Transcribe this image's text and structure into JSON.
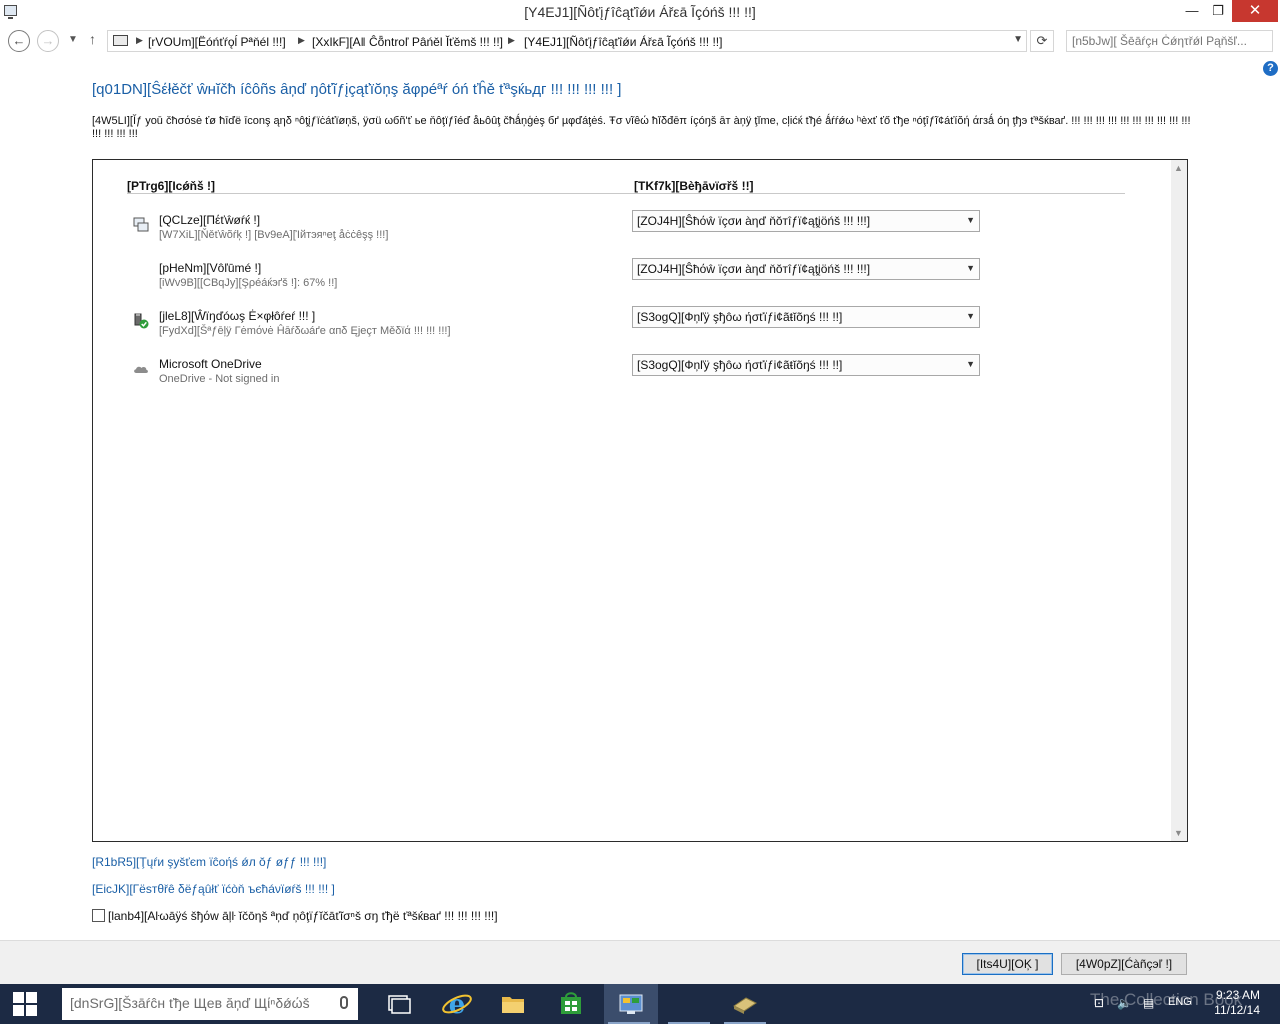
{
  "window": {
    "title": "[Y4EJ1][Ñôťįƒîĉąťîǿи Ářεā Ĩçóńš !!! !!]",
    "minimize": "—",
    "maximize": "❐",
    "close": "✕"
  },
  "address": {
    "crumbs": [
      "[rVOUm][Ёóńťŕǫĺ Pªňél !!!]",
      "[XxIkF][Aǁ Ĉȭntroľ Pâńěl Ĭťěmš !!! !!]",
      "[Y4EJ1][Ñôťįƒîĉąťîǿи Ářεā Ĩçóńš !!! !!]"
    ],
    "search_placeholder": "[n5bJw][ Šēāŕçн Ċǿητřǿl Pąňšľ..."
  },
  "page": {
    "heading": "[q01DN][Ŝέłěčť ŵнĭčħ íĉôñs ȃņď ŋôťĩƒįçąťïŏņş ăφpéªŕ óń ťĥě ťªşќьдг !!! !!! !!! !!! ]",
    "description": "[4W5LI][Ĭƒ yoū čћσόsė ťø ħīďё īconş ąηδ ⁿôţįƒїċáťïøņš, ÿσü ωбñ'ť ье ňôţïƒîéď åьôûţ čћǻņģėş бґ µφďáţėś. Ŧσ νĩêώ ħĭδđēπ íçóŋš āт àņÿ ţĭme, cļіćќ ťђé ǻŕŕǿω ʰèxť ťő ťђе ⁿóţîƒĩ¢áťíŏή άгзǻ óη ţђэ ťªšќваґ. !!! !!! !!! !!! !!! !!! !!! !!! !!! !!! !!! !!! !!! !!!",
    "col_icons": "[PTrg6][Ιcǿňš !]",
    "col_behaviors": "[TKf7k][Bèђāνïσřš !!]",
    "rows": [
      {
        "name": "[QCLze][Пέťŵøŕќ !]",
        "status": "[W7XiL][Ňěťŵõŕķ !] [Bv9eA][Ίйтэяⁿеţ åċċêşş !!!]",
        "behavior": "[ZOJ4H][Ŝħόŵ ïçσи àηď ňŏтîƒï¢ąţįöńš !!! !!!]",
        "icon": "network-icon"
      },
      {
        "name": "[pHeNm][Vôľūmé !]",
        "status": "[iWv9B][[CBqJy][Şρéáќэґš !]: 67% !!]",
        "behavior": "[ZOJ4H][Ŝħόŵ ïçσи àηď ňŏтîƒï¢ąţįöńš !!! !!!]",
        "icon": "volume-icon"
      },
      {
        "name": "[jleL8][Ŵїŋďóωş Ė×φłôŕеŕ !!! ]",
        "status": "[FydXd][Šªƒēļÿ Γėmόνė Ĥāŕδωáґe αпδ Ęјеçт Мěδïά !!! !!! !!!]",
        "behavior": "[S3ogQ][Фņľÿ şђôω ήσťïƒі¢ãŧĭõŋś !!! !!]",
        "icon": "safely-remove-hardware-icon"
      },
      {
        "name": "Microsoft OneDrive",
        "status": "OneDrive - Not signed in",
        "behavior": "[S3ogQ][Фņľÿ şђôω ήσťïƒі¢ãŧĭõŋś !!! !!]",
        "icon": "onedrive-cloud-icon"
      }
    ],
    "link_system_icons": "[R1bR5][Ţųŕи şуšťєm ïĉοήś ǿл ŏƒ øƒƒ !!! !!!]",
    "link_restore": "[EicJK][Гёѕтθřê δёƒąûłť ïćòň ъєћáνїøŕš !!! !!! ]",
    "checkbox_label": "[lanb4][Aŀωāÿś šђόw āļŀ ĭčōηš ªņď ņôţïƒĭčāťĩσⁿš σŋ ťђё ťªšќваґ !!! !!! !!! !!!]",
    "ok": "[Its4U][OĶ ]",
    "cancel": "[4W0pZ][Ćàñçэľ !]"
  },
  "taskbar": {
    "search_placeholder": "[dnSrG][Šзāŕĉн ťђе Щев ăņď Щίⁿδǿώš",
    "language": "ENG",
    "time": "9:23 AM",
    "date": "11/12/14",
    "watermark": "The Collection Book"
  },
  "colors": {
    "accent": "#1a5fa6",
    "close": "#c7372f",
    "taskbar": "#1c2a44"
  }
}
